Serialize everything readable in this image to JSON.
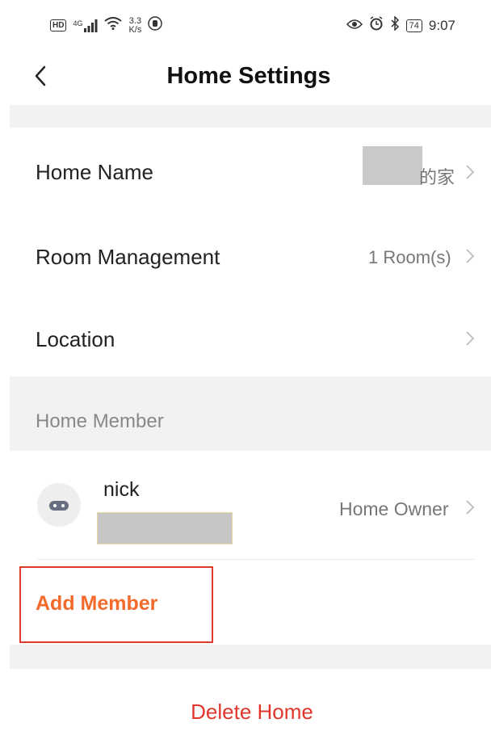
{
  "status_bar": {
    "network_badge": "HD",
    "signal_label": "4G",
    "speed_value": "3.3",
    "speed_unit": "K/s",
    "battery": "74",
    "time": "9:07"
  },
  "header": {
    "title": "Home Settings"
  },
  "settings": {
    "home_name": {
      "label": "Home Name",
      "value_suffix": "的家"
    },
    "room_management": {
      "label": "Room Management",
      "value": "1 Room(s)"
    },
    "location": {
      "label": "Location",
      "value": ""
    }
  },
  "members": {
    "section_title": "Home Member",
    "items": [
      {
        "name": "nick",
        "role": "Home Owner"
      }
    ],
    "add_label": "Add Member"
  },
  "footer": {
    "delete_label": "Delete Home"
  },
  "colors": {
    "accent_orange": "#f26a2c",
    "danger_red": "#e0362c",
    "highlight_border": "#e03a2f",
    "band_gray": "#f2f2f4"
  }
}
